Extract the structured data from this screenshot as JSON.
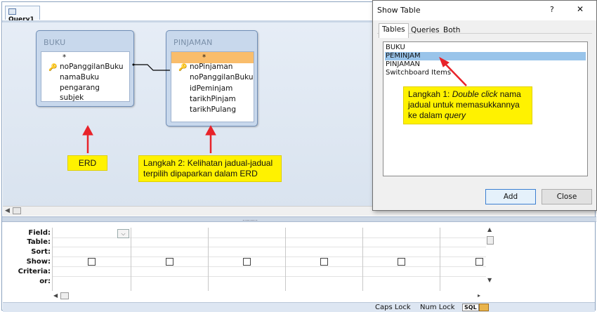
{
  "window": {
    "tab_label": "Query1"
  },
  "tables": {
    "buku": {
      "title": "BUKU",
      "fields": [
        "*",
        "noPanggilanBuku",
        "namaBuku",
        "pengarang",
        "subjek"
      ],
      "key_field": "noPanggilanBuku"
    },
    "pinjaman": {
      "title": "PINJAMAN",
      "fields": [
        "*",
        "noPinjaman",
        "noPanggilanBuku",
        "idPeminjam",
        "tarikhPinjam",
        "tarikhPulang"
      ],
      "key_field": "noPinjaman"
    }
  },
  "annotations": {
    "erd": "ERD",
    "langkah2_line1": "Langkah 2: Kelihatan jadual-jadual",
    "langkah2_line2": "terpilih dipaparkan dalam ERD",
    "langkah1_prefix": "Langkah 1: ",
    "langkah1_italic": "Double click",
    "langkah1_rest": " nama",
    "langkah1_line2": "jadual untuk memasukkannya",
    "langkah1_line3_prefix": "ke dalam ",
    "langkah1_line3_italic": "query",
    "arrow_color": "#e8232a",
    "highlight_color": "#fff200"
  },
  "grid": {
    "row_labels": [
      "Field:",
      "Table:",
      "Sort:",
      "Show:",
      "Criteria:",
      "or:"
    ]
  },
  "status_bar": {
    "caps_lock": "Caps Lock",
    "num_lock": "Num Lock",
    "sql_label": "SQL"
  },
  "dialog": {
    "title": "Show Table",
    "help": "?",
    "close": "✕",
    "tabs": [
      "Tables",
      "Queries",
      "Both"
    ],
    "items": [
      "BUKU",
      "PEMINJAM",
      "PINJAMAN",
      "Switchboard Items"
    ],
    "selected_index": 1,
    "add_label": "Add",
    "close_label": "Close"
  }
}
